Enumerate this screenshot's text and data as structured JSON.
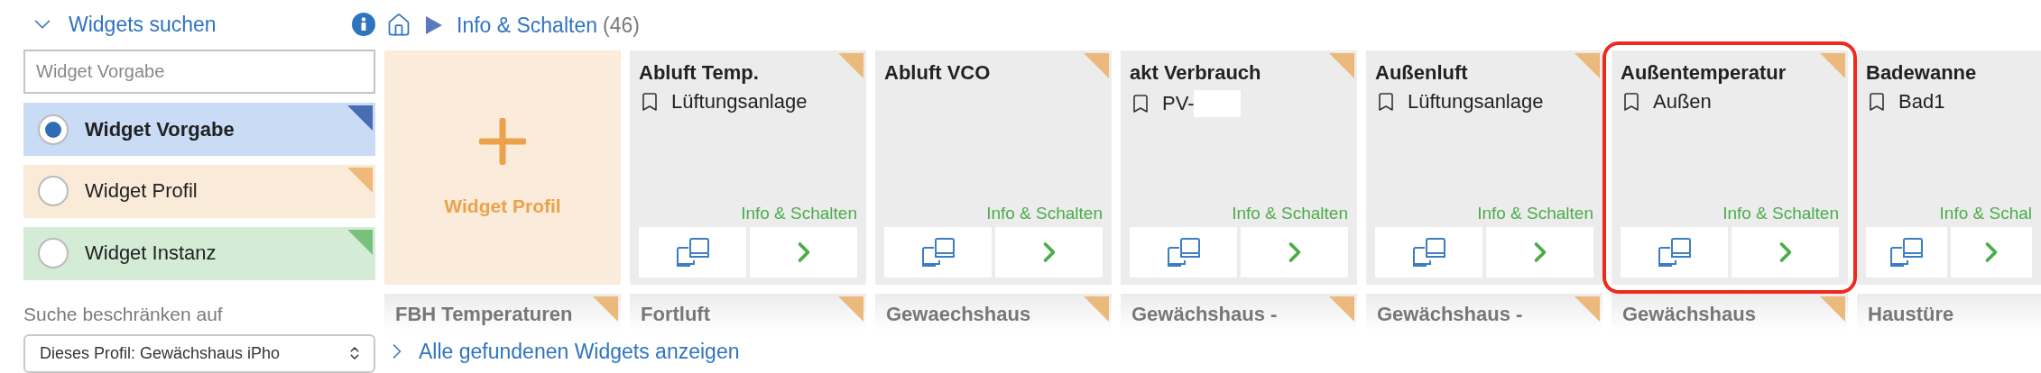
{
  "search_panel": {
    "title": "Widgets suchen",
    "expanded": true,
    "search": {
      "placeholder": "Widget Vorgabe"
    },
    "types": [
      {
        "label": "Widget Vorgabe",
        "selected": true,
        "kind": "vorgabe",
        "color": "#4a6cb3"
      },
      {
        "label": "Widget Profil",
        "selected": false,
        "kind": "profil",
        "color": "#f0b97a"
      },
      {
        "label": "Widget Instanz",
        "selected": false,
        "kind": "instanz",
        "color": "#78c07c"
      }
    ],
    "restrict_label": "Suche beschränken auf",
    "restrict_select": {
      "value": "Dieses Profil: Gewächshaus iPho"
    }
  },
  "breadcrumb": {
    "title": "Info & Schalten",
    "count": "(46)"
  },
  "add_tile": {
    "label": "Widget Profil"
  },
  "cards": [
    {
      "title": "Abluft Temp.",
      "location": "Lüftungsanlage",
      "category": "Info & Schalten",
      "tagged": true,
      "highlighted": false
    },
    {
      "title": "Abluft VCO",
      "category": "Info & Schalten",
      "tagged": true,
      "highlighted": false
    },
    {
      "title": "akt Verbrauch",
      "location": "PV-",
      "redacted": true,
      "category": "Info & Schalten",
      "tagged": true,
      "highlighted": false
    },
    {
      "title": "Außenluft",
      "location": "Lüftungsanlage",
      "category": "Info & Schalten",
      "tagged": true,
      "highlighted": false
    },
    {
      "title": "Außentemperatur",
      "location": "Außen",
      "category": "Info & Schalten",
      "tagged": true,
      "highlighted": true
    },
    {
      "title": "Badewanne",
      "location": "Bad1",
      "category": "Info & Schal"
    }
  ],
  "next_row": [
    {
      "title": "FBH Temperaturen",
      "tagged": true
    },
    {
      "title": "Fortluft",
      "tagged": true
    },
    {
      "title": "Gewaechshaus",
      "tagged": true
    },
    {
      "title": "Gewächshaus -",
      "tagged": true
    },
    {
      "title": "Gewächshaus -",
      "tagged": true
    },
    {
      "title": "Gewächshaus",
      "tagged": true
    },
    {
      "title": "Haustüre"
    }
  ],
  "show_all_link": "Alle gefundenen Widgets anzeigen"
}
